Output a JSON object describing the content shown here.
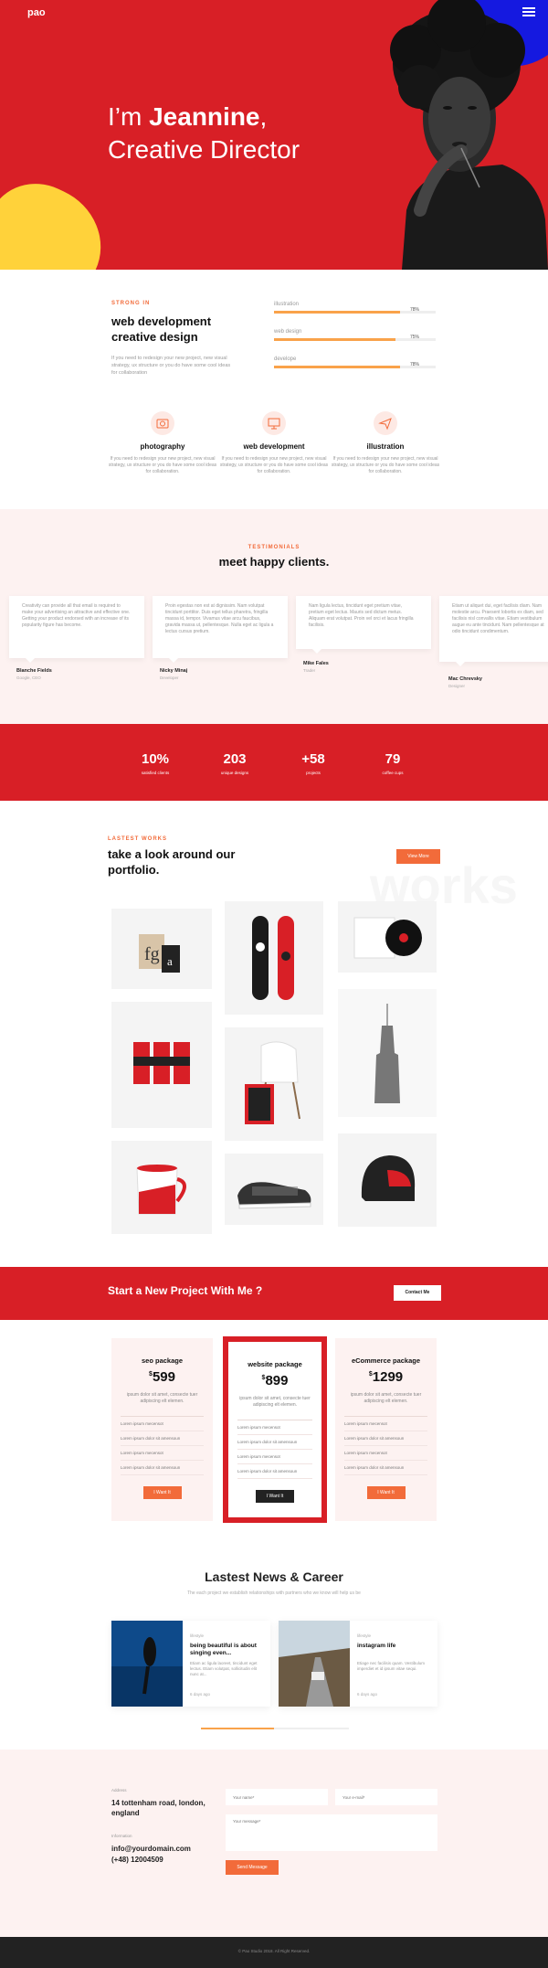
{
  "brand": {
    "logo": "pao",
    "accent": "#d81f26",
    "orange": "#f26b3a",
    "yellow": "#ffd23a",
    "blue": "#1519e0"
  },
  "hero": {
    "greeting": "I’m ",
    "name": "Jeannine",
    "role": "Creative Director"
  },
  "skills": {
    "tagline": "strong in",
    "title": "web development creative design",
    "text": "If you need to redesign your new project, new visual strategy, ux structure or you do have some cool ideas for collaboration",
    "bars": [
      {
        "label": "illustration",
        "percent": 78,
        "display": "78%"
      },
      {
        "label": "web design",
        "percent": 75,
        "display": "75%"
      },
      {
        "label": "develope",
        "percent": 78,
        "display": "78%"
      }
    ]
  },
  "services": [
    {
      "icon": "camera-icon",
      "title": "photography",
      "text": "If you need to redesign your new project, new visual strategy, ux structure or you do have some cool ideas for collaboration."
    },
    {
      "icon": "monitor-icon",
      "title": "web development",
      "text": "If you need to redesign your new project, new visual strategy, ux structure or you do have some cool ideas for collaboration."
    },
    {
      "icon": "paper-plane-icon",
      "title": "illustration",
      "text": "If you need to redesign your new project, new visual strategy, ux structure or you do have some cool ideas for collaboration."
    }
  ],
  "testimonials": {
    "tagline": "testimonials",
    "title": "meet happy clients.",
    "items": [
      {
        "quote": "Creativity can provide all that email is required to make your advertising an attractive and effective one. Getting your product endorsed with an increase of its popularity figure has become.",
        "name": "Blanche Fields",
        "role": "Google, CEO"
      },
      {
        "quote": "Proin egestas non est at dignissim. Nam volutpat tincidunt porttitor. Duis eget tellus pharetra, fringilla massa id, tempor. Vivamus vitae arcu faucibus, gravida massa ut, pellentesque. Nulla eget ac ligula a lectus cursus pretium.",
        "name": "Nicky Minaj",
        "role": "Developer"
      },
      {
        "quote": "Nam ligula lectus, tincidunt eget pretium vitae, pretium eget lectus. Mauris sed dictum metus. Aliquam erat volutpat. Proin vel orci et lacus fringilla facilisis.",
        "name": "Mike Fales",
        "role": "Trader"
      },
      {
        "quote": "Etiam ut aliquet dui, eget facilisis diam. Nam molestie arcu. Praesent lobortis ex diam, sed facilisis nisl convallis vitae. Etiam vestibulum augue eu ante tincidunt. Nam pellentesque at odio tincidunt condimentum.",
        "name": "Mac Chrevsky",
        "role": "Designer"
      }
    ]
  },
  "stats": [
    {
      "value": "10%",
      "label": "satisfied clients"
    },
    {
      "value": "203",
      "label": "unique designs"
    },
    {
      "value": "+58",
      "label": "projects"
    },
    {
      "value": "79",
      "label": "coffee cups"
    }
  ],
  "portfolio": {
    "tagline": "lastest works",
    "title": "take a look around our portfolio.",
    "button": "View More",
    "ghost": "works",
    "tiles": [
      "shopping-bag-image",
      "skateboard-image",
      "vinyl-record-image",
      "cans-image",
      "chair-image",
      "skyscraper-image",
      "mug-image",
      "sneaker-image",
      "helmet-image"
    ]
  },
  "cta": {
    "title": "Start a New Project With Me ?",
    "button": "Contact Me"
  },
  "pricing": [
    {
      "title": "seo package",
      "currency": "$",
      "price": "599",
      "desc": "ipsum dolor sit amet, consecte tuer adipiscing elt elemen.",
      "features": [
        "Lorem ipsum mecensot",
        "Lorem ipsum dolor sit amensoun",
        "Lorem ipsum mecensot",
        "Lorem ipsum dolor sit amensoun"
      ],
      "button": "I Want It"
    },
    {
      "title": "website package",
      "currency": "$",
      "price": "899",
      "desc": "ipsum dolor sit amet, consecte tuer adipiscing elt elemen.",
      "features": [
        "Lorem ipsum mecensot",
        "Lorem ipsum dolor sit amensoun",
        "Lorem ipsum mecensot",
        "Lorem ipsum dolor sit amensoun"
      ],
      "button": "I Want It"
    },
    {
      "title": "eCommerce package",
      "currency": "$",
      "price": "1299",
      "desc": "ipsum dolor sit amet, consecte tuer adipiscing elt elemen.",
      "features": [
        "Lorem ipsum mecensot",
        "Lorem ipsum dolor sit amensoun",
        "Lorem ipsum mecensot",
        "Lorem ipsum dolor sit amensoun"
      ],
      "button": "I Want It"
    }
  ],
  "news": {
    "title": "Lastest News & Career",
    "subtitle": "The each project we establish relationships with partners who we know will help us be",
    "items": [
      {
        "category": "lifestyle",
        "title": "being beautiful is about singing even...",
        "excerpt": "Etiam ac ligula laoreet, tincidunt eget lectus. Etiam volutpat, sollicitudin elit nunc at...",
        "ago": "6 days ago"
      },
      {
        "category": "lifestyle",
        "title": "instagram life",
        "excerpt": "Etiage nec facilisis quam. Vestibulum imperdiet et id ipsum vitae sequi.",
        "ago": "6 days ago"
      }
    ]
  },
  "contact": {
    "address_label": "Address",
    "address": "14 tottenham road, london, england",
    "info_label": "Information",
    "email": "info@yourdomain.com",
    "phone": "(+48) 12004509",
    "name_placeholder": "Your name*",
    "email_placeholder": "Your e-mail*",
    "message_placeholder": "Your message*",
    "send": "Send Message"
  },
  "footer": {
    "copyright": "© Pao Studio 2018. All Right Reserved."
  }
}
